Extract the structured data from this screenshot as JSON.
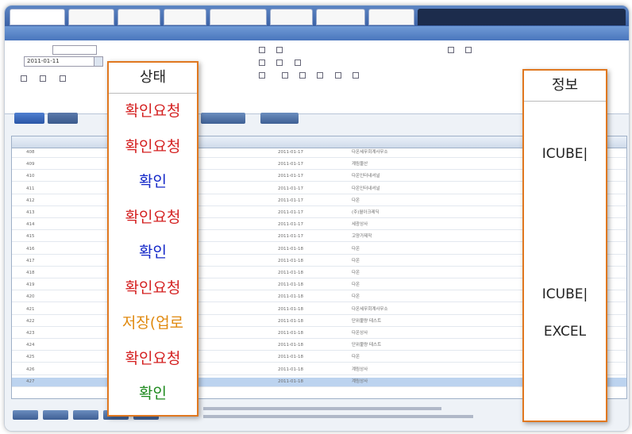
{
  "callout_left": {
    "header": "상태",
    "items": [
      {
        "label": "확인요청",
        "color": "#d42020"
      },
      {
        "label": "확인요청",
        "color": "#d42020"
      },
      {
        "label": "확인",
        "color": "#1428c8"
      },
      {
        "label": "확인요청",
        "color": "#d42020"
      },
      {
        "label": "확인",
        "color": "#1428c8"
      },
      {
        "label": "확인요청",
        "color": "#d42020"
      },
      {
        "label": "저장(업로",
        "color": "#e08a10"
      },
      {
        "label": "확인요청",
        "color": "#d42020"
      },
      {
        "label": "확인",
        "color": "#1e8a1e"
      }
    ]
  },
  "callout_right": {
    "header": "정보",
    "items": [
      "ICUBE|",
      "ICUBE|",
      "EXCEL"
    ]
  },
  "grid_rows": [
    {
      "no": "408",
      "date": "2011-01-17",
      "name": "다온세무회계사무소"
    },
    {
      "no": "409",
      "date": "2011-01-17",
      "name": "계림물산"
    },
    {
      "no": "410",
      "date": "2011-01-17",
      "name": "다온인터내셔널"
    },
    {
      "no": "411",
      "date": "2011-01-17",
      "name": "다온인터내셔널"
    },
    {
      "no": "412",
      "date": "2011-01-17",
      "name": "다온"
    },
    {
      "no": "413",
      "date": "2011-01-17",
      "name": "(주)월아크레딕"
    },
    {
      "no": "414",
      "date": "2011-01-17",
      "name": "세광상사"
    },
    {
      "no": "415",
      "date": "2011-01-17",
      "name": "고양가제작"
    },
    {
      "no": "416",
      "date": "2011-01-18",
      "name": "다온"
    },
    {
      "no": "417",
      "date": "2011-01-18",
      "name": "다온"
    },
    {
      "no": "418",
      "date": "2011-01-18",
      "name": "다온"
    },
    {
      "no": "419",
      "date": "2011-01-18",
      "name": "다온"
    },
    {
      "no": "420",
      "date": "2011-01-18",
      "name": "다온"
    },
    {
      "no": "421",
      "date": "2011-01-18",
      "name": "다온세무회계사무소"
    },
    {
      "no": "422",
      "date": "2011-01-18",
      "name": "단위불량 테스트"
    },
    {
      "no": "423",
      "date": "2011-01-18",
      "name": "다온상사"
    },
    {
      "no": "424",
      "date": "2011-01-18",
      "name": "단위불량 테스트"
    },
    {
      "no": "425",
      "date": "2011-01-18",
      "name": "다온"
    },
    {
      "no": "426",
      "date": "2011-01-18",
      "name": "계림상사"
    },
    {
      "no": "427",
      "date": "2011-01-18",
      "name": "계림상사"
    }
  ],
  "filter": {
    "date_value": "2011-01-11"
  },
  "colors": {
    "callout_border": "#e07820",
    "header_blue": "#4a76bd",
    "selected_row": "#bcd3ef"
  }
}
